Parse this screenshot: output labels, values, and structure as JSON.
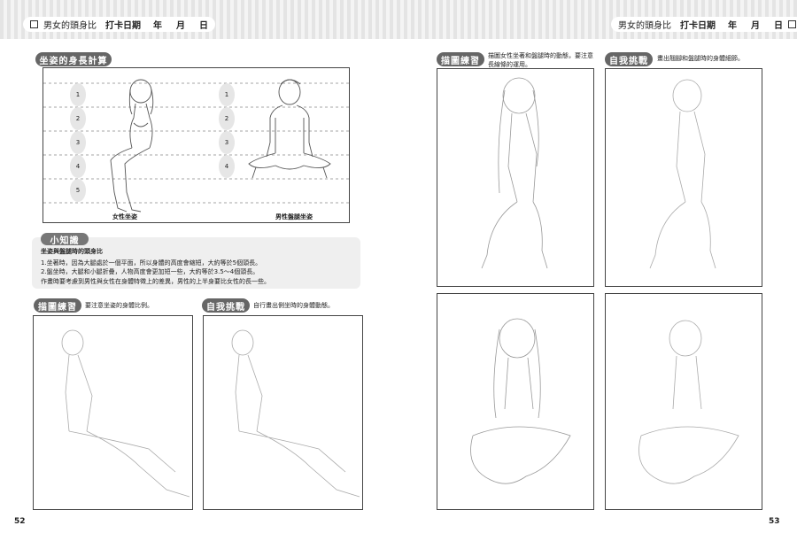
{
  "header": {
    "title": "男女的頭身比",
    "checkin_label": "打卡日期",
    "year": "年",
    "month": "月",
    "day": "日"
  },
  "left": {
    "section_title": "坐姿的身長計算",
    "ruler_numbers_female": [
      "1",
      "2",
      "3",
      "4",
      "5"
    ],
    "ruler_numbers_male": [
      "1",
      "2",
      "3",
      "4"
    ],
    "caption_female": "女性坐姿",
    "caption_male": "男性盤腿坐姿",
    "tip": {
      "badge": "小知識",
      "heading": "坐姿與盤腿時的頭身比",
      "line1": "1.坐著時，因為大腿處於一個平面，所以身體的高度會縮短，大約等於5個頭長。",
      "line2": "2.盤坐時，大腿和小腿折疊，人物高度會更加短一些，大約等於3.5～4個頭長。",
      "line3": "作畫時要考慮到男性與女性在身體特徵上的差異，男性的上半身要比女性的長一些。"
    },
    "practice": {
      "badge": "描圖練習",
      "desc": "要注意坐姿的身體比例。"
    },
    "challenge": {
      "badge": "自我挑戰",
      "desc": "自行畫出側坐時的身體動態。"
    },
    "page_number": "52"
  },
  "right": {
    "practice": {
      "badge": "描圖練習",
      "desc_line1": "描圖女性坐著和盤腿時的動態，要注意",
      "desc_line2": "長線條的運用。"
    },
    "challenge": {
      "badge": "自我挑戰",
      "desc": "畫出翹腳和盤腿時的身體細節。"
    },
    "page_number": "53"
  }
}
